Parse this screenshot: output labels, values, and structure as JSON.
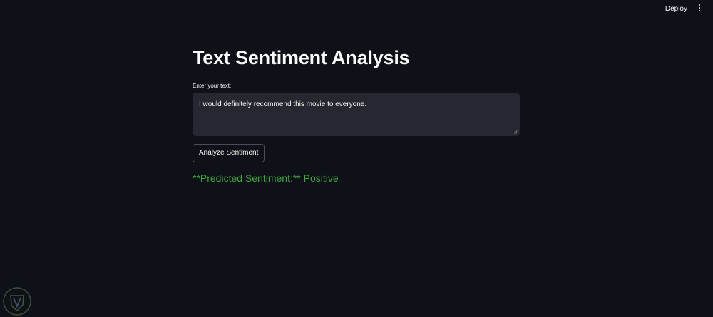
{
  "header": {
    "deploy_label": "Deploy",
    "menu_icon": "kebab-menu-icon"
  },
  "main": {
    "title": "Text Sentiment Analysis",
    "input_label": "Enter your text:",
    "input_value": "I would definitely recommend this movie to everyone.",
    "analyze_button_label": "Analyze Sentiment",
    "result_text": "**Predicted Sentiment:** Positive"
  },
  "colors": {
    "background": "#0e1117",
    "input_background": "#262730",
    "result_green": "#3fa33f",
    "text": "#fafafa"
  }
}
